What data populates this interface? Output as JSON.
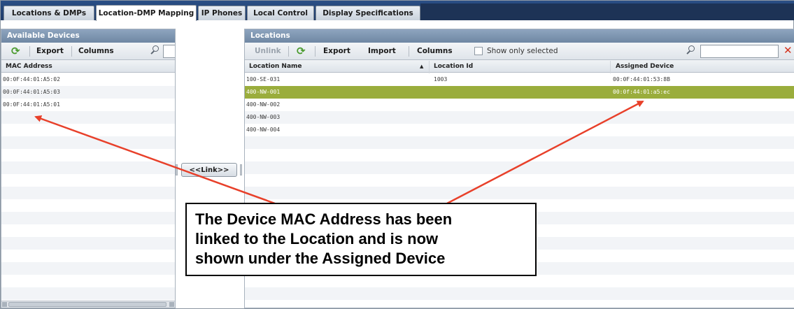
{
  "tabs": [
    {
      "label": "Locations & DMPs"
    },
    {
      "label": "Location-DMP Mapping"
    },
    {
      "label": "IP Phones"
    },
    {
      "label": "Local Control"
    },
    {
      "label": "Display Specifications"
    }
  ],
  "available_devices": {
    "title": "Available Devices",
    "toolbar": {
      "refresh_icon": "refresh-icon",
      "export_label": "Export",
      "columns_label": "Columns",
      "search_icon": "search-icon",
      "search_value": ""
    },
    "column_header": "MAC Address",
    "rows": [
      {
        "mac": "00:0F:44:01:A5:02"
      },
      {
        "mac": "00:0F:44:01:A5:03"
      },
      {
        "mac": "00:0F:44:01:A5:01"
      }
    ]
  },
  "link_button": "<<Link>>",
  "locations": {
    "title": "Locations",
    "toolbar": {
      "unlink_label": "Unlink",
      "refresh_icon": "refresh-icon",
      "export_label": "Export",
      "import_label": "Import",
      "columns_label": "Columns",
      "show_only_selected_label": "Show only selected",
      "search_icon": "search-icon",
      "search_value": "",
      "clear_icon": "clear-icon"
    },
    "columns": [
      "Location Name",
      "Location Id",
      "Assigned Device"
    ],
    "sort_indicator": "▲",
    "rows": [
      {
        "name": "100-SE-031",
        "id": "1003",
        "device": "00:0F:44:01:53:8B",
        "selected": false
      },
      {
        "name": "400-NW-001",
        "id": "",
        "device": "00:0f:44:01:a5:ec",
        "selected": true
      },
      {
        "name": "400-NW-002",
        "id": "",
        "device": "",
        "selected": false
      },
      {
        "name": "400-NW-003",
        "id": "",
        "device": "",
        "selected": false
      },
      {
        "name": "400-NW-004",
        "id": "",
        "device": "",
        "selected": false
      }
    ]
  },
  "callout": {
    "lines": [
      "The Device MAC Address has been",
      "linked to the Location and is now",
      "shown under the Assigned Device"
    ]
  },
  "colors": {
    "selected_row": "#9aad3c",
    "arrow": "#e8402a",
    "tab_bar": "#1f3b68",
    "panel_title": "#7a90ab"
  }
}
